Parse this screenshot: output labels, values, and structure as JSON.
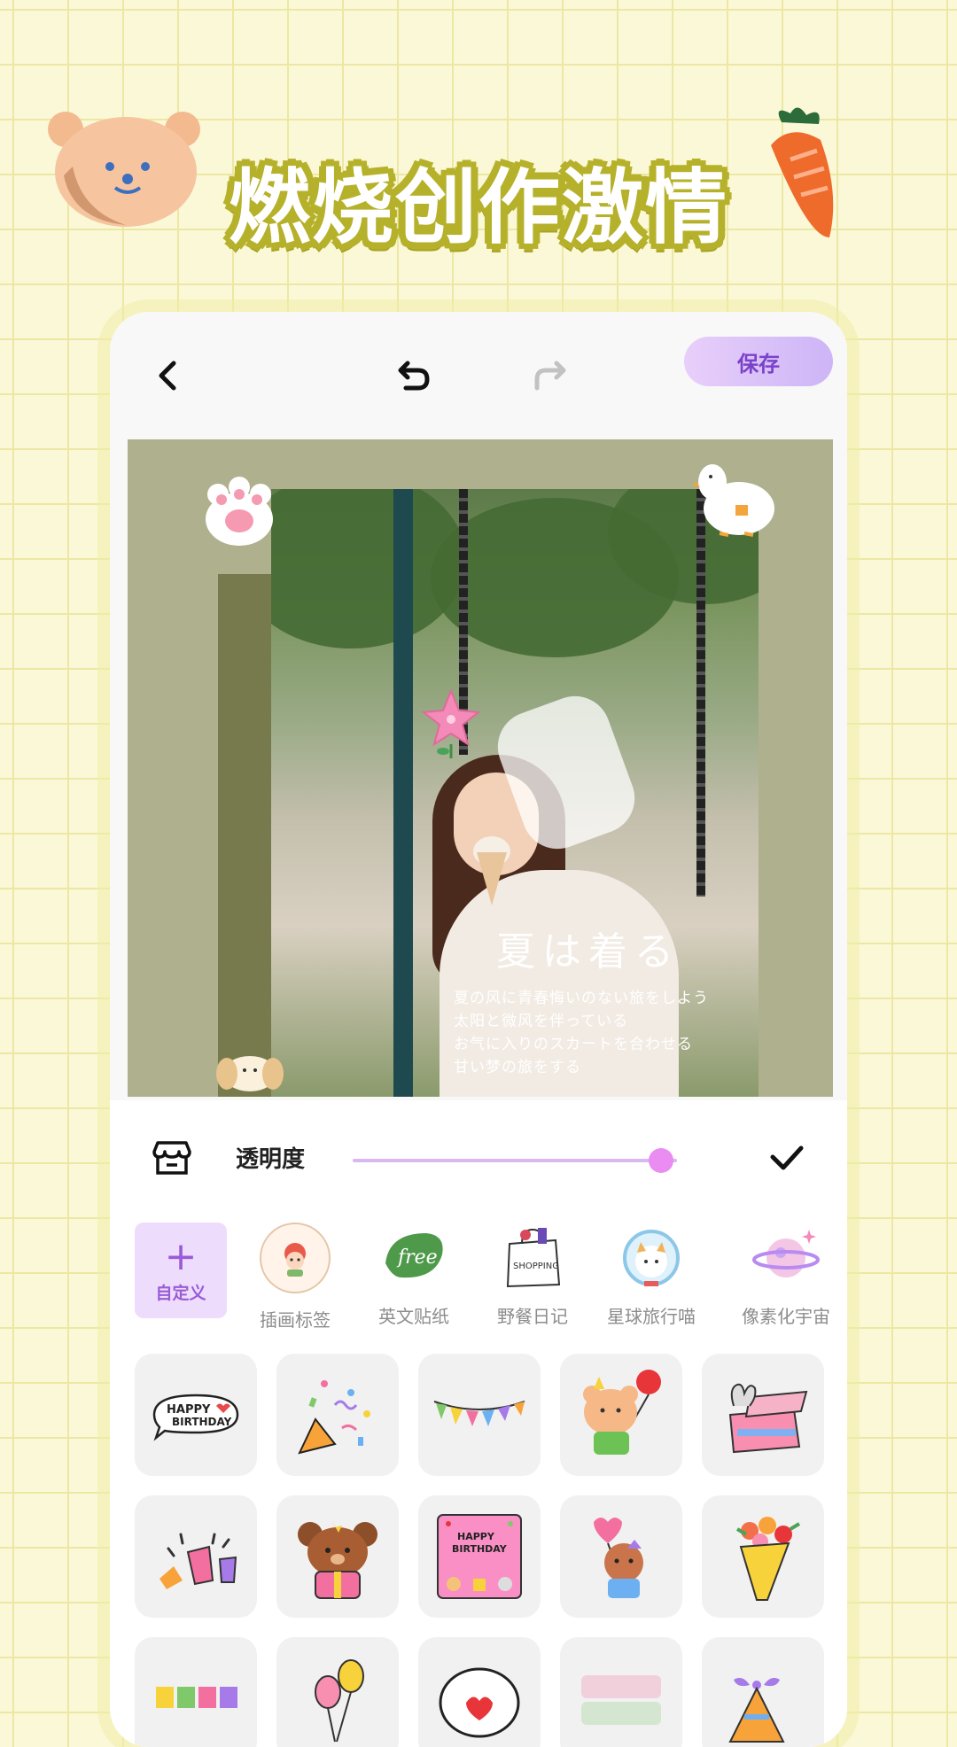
{
  "banner": {
    "title": "燃烧创作激情"
  },
  "decorations": {
    "left": "bear-face-icon",
    "right": "carrot-icon"
  },
  "toolbar": {
    "back_icon": "chevron-left-icon",
    "undo_icon": "undo-icon",
    "redo_icon": "redo-icon",
    "save_label": "保存",
    "accent": "#7a42c9"
  },
  "canvas": {
    "title": "夏は着る",
    "lines": [
      "夏の风に青春悔いのない旅をしよう",
      "太阳と微风を伴っている",
      "お气に入りのスカートを合わせる",
      "甘い梦の旅をする"
    ],
    "frame_color": "#aeb08e",
    "stickers": [
      "paw-icon",
      "duck-icon",
      "flower-icon",
      "bunny-icon"
    ]
  },
  "panel": {
    "shop_icon": "sticker-shop-icon",
    "opacity_label": "透明度",
    "opacity_value": 0.95,
    "confirm_icon": "check-icon",
    "custom_label": "自定义",
    "categories": [
      {
        "label": "插画标签",
        "icon": "illustration-tag-icon"
      },
      {
        "label": "英文贴纸",
        "icon": "free-leaf-icon"
      },
      {
        "label": "野餐日记",
        "icon": "shopping-bag-icon"
      },
      {
        "label": "星球旅行喵",
        "icon": "astronaut-cat-icon"
      },
      {
        "label": "像素化宇宙",
        "icon": "planet-icon"
      }
    ],
    "stickers": [
      "happy-birthday-bubble-icon",
      "confetti-icon",
      "bunting-icon",
      "bear-balloon-icon",
      "bunny-gift-box-icon",
      "party-poppers-icon",
      "bear-gift-icon",
      "birthday-card-icon",
      "dog-heart-balloon-icon",
      "flower-bouquet-icon",
      "birthday-text-icon",
      "balloons-icon",
      "heart-speech-icon",
      "happy-birth-text-icon",
      "party-hat-icon"
    ]
  }
}
